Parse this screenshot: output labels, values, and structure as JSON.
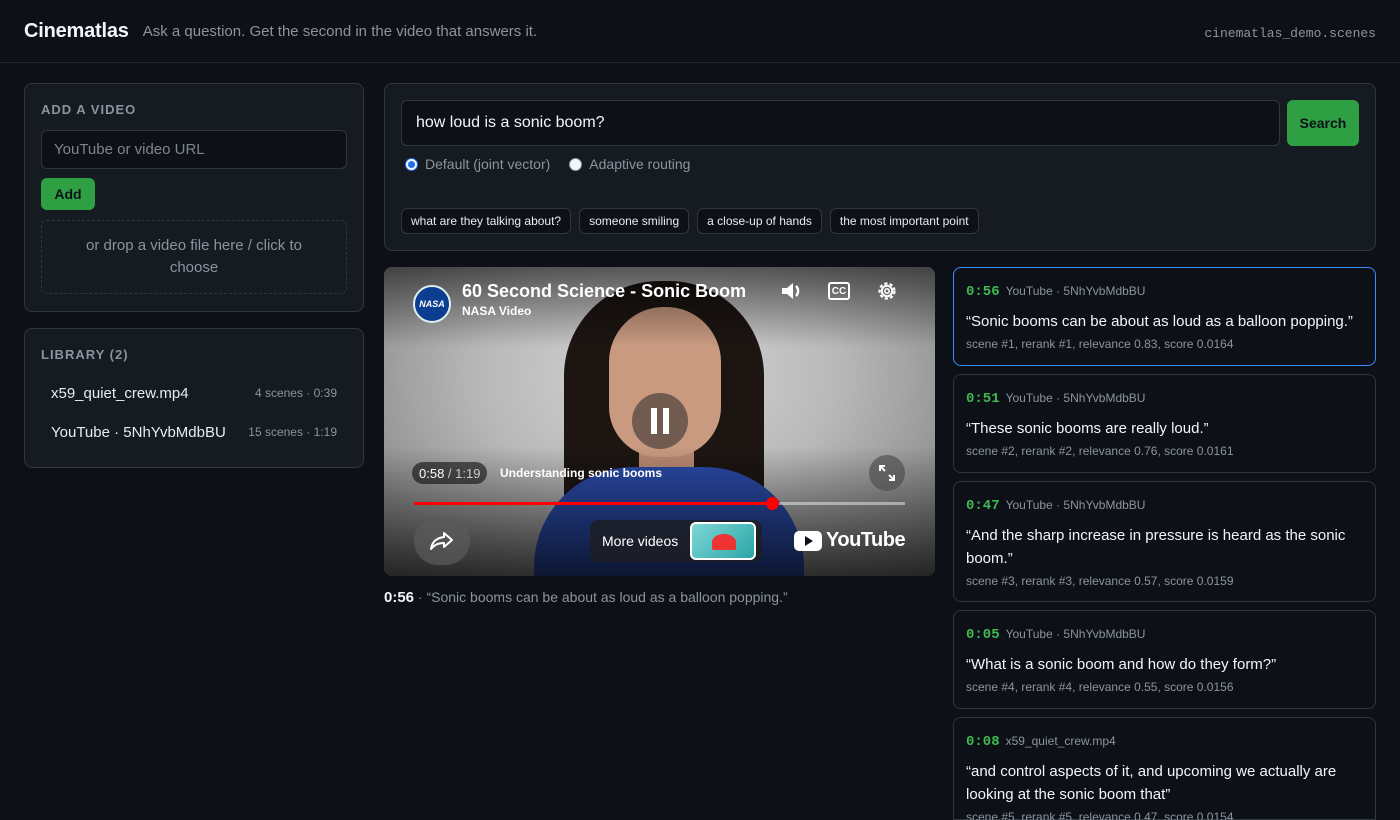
{
  "header": {
    "brand": "Cinematlas",
    "tagline": "Ask a question. Get the second in the video that answers it.",
    "dataset": "cinematlas_demo.scenes"
  },
  "add_video": {
    "title": "ADD A VIDEO",
    "url_placeholder": "YouTube or video URL",
    "add_label": "Add",
    "dropzone_text": "or drop a video file here / click to choose"
  },
  "library": {
    "title": "LIBRARY (2)",
    "items": [
      {
        "name": "x59_quiet_crew.mp4",
        "meta": "4 scenes · 0:39"
      },
      {
        "name": "YouTube · 5NhYvbMdbBU",
        "meta": "15 scenes · 1:19"
      }
    ]
  },
  "search": {
    "query": "how loud is a sonic boom?",
    "button_label": "Search",
    "modes": [
      {
        "label": "Default (joint vector)",
        "selected": true
      },
      {
        "label": "Adaptive routing",
        "selected": false
      }
    ],
    "suggestions": [
      "what are they talking about?",
      "someone smiling",
      "a close-up of hands",
      "the most important point"
    ]
  },
  "player": {
    "title": "60 Second Science - Sonic Boom",
    "channel": "NASA Video",
    "logo_text": "NASA",
    "time_current": "0:58",
    "time_total": "1:19",
    "time_separator": " / ",
    "chapter": "Understanding sonic booms",
    "progress_fraction": 0.73,
    "more_videos_label": "More videos",
    "youtube_label": "YouTube",
    "icons": [
      "volume-icon",
      "cc-icon",
      "gear-icon",
      "pause-icon",
      "fullscreen-icon",
      "share-icon"
    ],
    "cc_text": "CC"
  },
  "now_playing": {
    "timestamp": "0:56",
    "separator": " · ",
    "quote": "“Sonic booms can be about as loud as a balloon popping.”"
  },
  "results": [
    {
      "ts": "0:56",
      "source": "YouTube · 5NhYvbMdbBU",
      "quote": "“Sonic booms can be about as loud as a balloon popping.”",
      "meta": "scene #1, rerank #1, relevance 0.83, score 0.0164",
      "active": true
    },
    {
      "ts": "0:51",
      "source": "YouTube · 5NhYvbMdbBU",
      "quote": "“These sonic booms are really loud.”",
      "meta": "scene #2, rerank #2, relevance 0.76, score 0.0161",
      "active": false
    },
    {
      "ts": "0:47",
      "source": "YouTube · 5NhYvbMdbBU",
      "quote": "“And the sharp increase in pressure is heard as the sonic boom.”",
      "meta": "scene #3, rerank #3, relevance 0.57, score 0.0159",
      "active": false
    },
    {
      "ts": "0:05",
      "source": "YouTube · 5NhYvbMdbBU",
      "quote": "“What is a sonic boom and how do they form?”",
      "meta": "scene #4, rerank #4, relevance 0.55, score 0.0156",
      "active": false
    },
    {
      "ts": "0:08",
      "source": "x59_quiet_crew.mp4",
      "quote": "“and control aspects of it, and upcoming we actually are looking at the sonic boom that”",
      "meta": "scene #5, rerank #5, relevance 0.47, score 0.0154",
      "active": false
    }
  ],
  "colors": {
    "accent_green": "#2ea043",
    "timestamp_green": "#3fb950",
    "active_border": "#388bfd",
    "progress_red": "#ff0000"
  }
}
